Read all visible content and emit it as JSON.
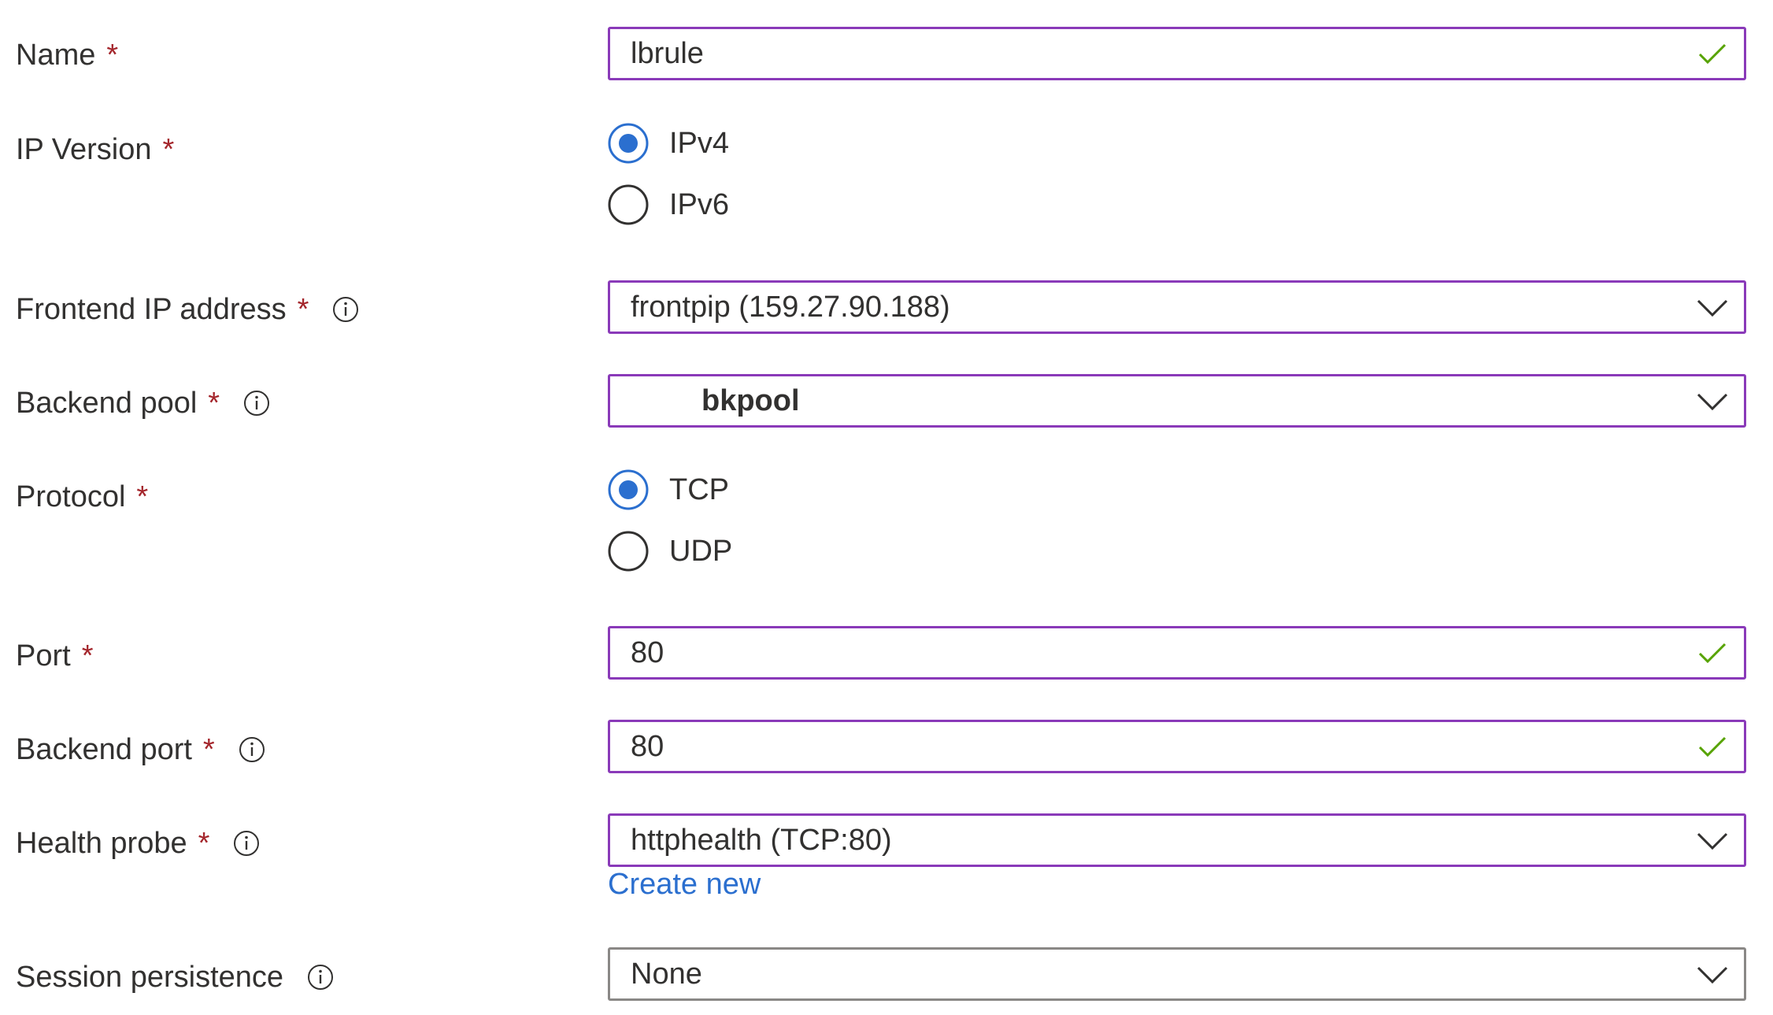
{
  "form": {
    "name": {
      "label": "Name",
      "required_mark": "*",
      "value": "lbrule",
      "status_icon": "check-icon"
    },
    "ip_version": {
      "label": "IP Version",
      "required_mark": "*",
      "options": [
        "IPv4",
        "IPv6"
      ],
      "selected": "IPv4"
    },
    "frontend_ip": {
      "label": "Frontend IP address",
      "required_mark": "*",
      "value": "frontpip (159.27.90.188)"
    },
    "backend_pool": {
      "label": "Backend pool",
      "required_mark": "*",
      "value": "bkpool"
    },
    "protocol": {
      "label": "Protocol",
      "required_mark": "*",
      "options": [
        "TCP",
        "UDP"
      ],
      "selected": "TCP"
    },
    "port": {
      "label": "Port",
      "required_mark": "*",
      "value": "80",
      "status_icon": "check-icon"
    },
    "backend_port": {
      "label": "Backend port",
      "required_mark": "*",
      "value": "80",
      "status_icon": "check-icon"
    },
    "health_probe": {
      "label": "Health probe",
      "required_mark": "*",
      "value": "httphealth (TCP:80)",
      "create_new": "Create new"
    },
    "session_persistence": {
      "label": "Session persistence",
      "value": "None"
    }
  },
  "colors": {
    "focus_border": "#8a3ab9",
    "neutral_border": "#8a8886",
    "required": "#a4262c",
    "check": "#57a300",
    "radio_selected": "#2b6fcf",
    "link": "#2b6fcf"
  }
}
